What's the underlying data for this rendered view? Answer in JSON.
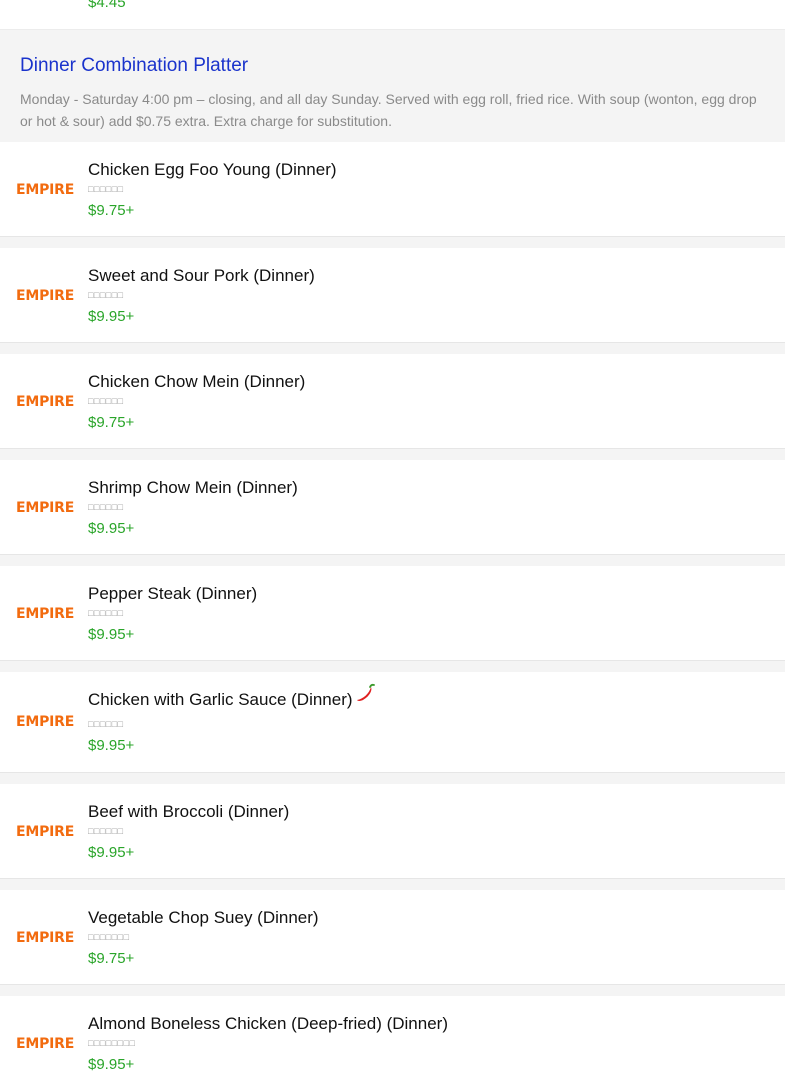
{
  "previous_item": {
    "price": "$4.45"
  },
  "section": {
    "title": "Dinner Combination Platter",
    "description": "Monday - Saturday 4:00 pm – closing, and all day Sunday. Served with egg roll, fried rice. With soup (wonton, egg drop or hot & sour) add $0.75 extra. Extra charge for substitution."
  },
  "brand": {
    "logo_text": "EMPIRE",
    "logo_color": "#f26b0f"
  },
  "colors": {
    "price": "#2aa52a",
    "section_title": "#1a33cc",
    "spicy_icon": "#e02020"
  },
  "items": [
    {
      "name": "Chicken Egg Foo Young (Dinner)",
      "subtext": "□□□□□□",
      "price": "$9.75+",
      "spicy": false
    },
    {
      "name": "Sweet and Sour Pork (Dinner)",
      "subtext": "□□□□□□",
      "price": "$9.95+",
      "spicy": false
    },
    {
      "name": "Chicken Chow Mein (Dinner)",
      "subtext": "□□□□□□",
      "price": "$9.75+",
      "spicy": false
    },
    {
      "name": "Shrimp Chow Mein (Dinner)",
      "subtext": "□□□□□□",
      "price": "$9.95+",
      "spicy": false
    },
    {
      "name": "Pepper Steak (Dinner)",
      "subtext": "□□□□□□",
      "price": "$9.95+",
      "spicy": false
    },
    {
      "name": "Chicken with Garlic Sauce (Dinner)",
      "subtext": "□□□□□□",
      "price": "$9.95+",
      "spicy": true,
      "spicy_icon": "chili-pepper-icon"
    },
    {
      "name": "Beef with Broccoli (Dinner)",
      "subtext": "□□□□□□",
      "price": "$9.95+",
      "spicy": false
    },
    {
      "name": "Vegetable Chop Suey (Dinner)",
      "subtext": "□□□□□□□",
      "price": "$9.75+",
      "spicy": false
    },
    {
      "name": "Almond Boneless Chicken (Deep-fried) (Dinner)",
      "subtext": "□□□□□□□□",
      "price": "$9.95+",
      "spicy": false
    }
  ]
}
